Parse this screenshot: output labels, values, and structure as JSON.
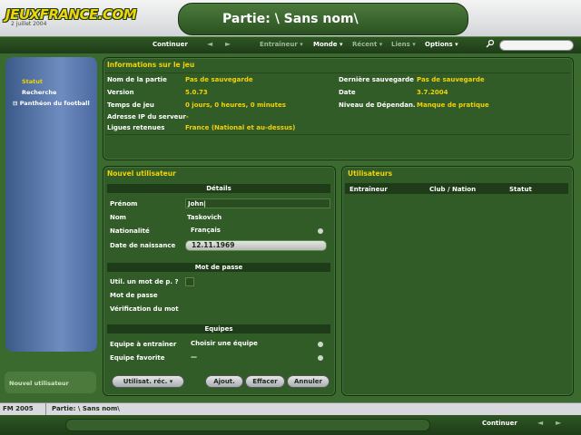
{
  "header": {
    "logo_text": "JEUXFRANCE.COM",
    "date": "2 juillet 2004",
    "title": "Partie: \\ Sans nom\\"
  },
  "nav": {
    "continue": "Continuer",
    "back": "◄",
    "forward": "►",
    "items": [
      "Entraîneur ▾",
      "Monde ▾",
      "Récent ▾",
      "Liens ▾",
      "Options ▾"
    ],
    "search_icon": "magnifier-icon"
  },
  "sidebar": {
    "items": [
      "Statut",
      "Recherche",
      "Panthéon du football"
    ],
    "bottom_label": "Nouvel utilisateur"
  },
  "info": {
    "title": "Informations sur le jeu",
    "rows_left": [
      {
        "label": "Nom de la partie",
        "value": "Pas de sauvegarde"
      },
      {
        "label": "Version",
        "value": "5.0.73"
      },
      {
        "label": "Temps de jeu",
        "value": "0 jours, 0 heures, 0 minutes"
      },
      {
        "label": "Adresse IP du serveur",
        "value": "-"
      },
      {
        "label": "Ligues retenues",
        "value": "France (National et au-dessus)"
      }
    ],
    "rows_right": [
      {
        "label": "Dernière sauvegarde",
        "value": "Pas de sauvegarde"
      },
      {
        "label": "Date",
        "value": "3.7.2004"
      },
      {
        "label": "Niveau de Dépendan.",
        "value": "Manque de pratique"
      }
    ]
  },
  "new_user": {
    "title": "Nouvel utilisateur",
    "details_header": "Détails",
    "firstname_label": "Prénom",
    "firstname_value": "John",
    "lastname_label": "Nom",
    "lastname_value": "Taskovich",
    "nationality_label": "Nationalité",
    "nationality_value": "Français",
    "dob_label": "Date de naissance",
    "dob_value": "12.11.1969",
    "password_header": "Mot de passe",
    "use_password_label": "Util. un mot de p. ?",
    "password_label": "Mot de passe",
    "verify_label": "Vérification du mot",
    "teams_header": "Equipes",
    "team_label": "Equipe à entraîner",
    "team_value": "Choisir une équipe",
    "fav_team_label": "Equipe favorite",
    "fav_team_value": "—",
    "buttons": {
      "recent": "Utilisat. réc. ▾",
      "add": "Ajout.",
      "clear": "Effacer",
      "cancel": "Annuler"
    }
  },
  "users": {
    "title": "Utilisateurs",
    "columns": [
      "Entraîneur",
      "Club / Nation",
      "Statut"
    ]
  },
  "status": {
    "app": "FM 2005",
    "game": "Partie: \\ Sans nom\\"
  },
  "footer": {
    "continue": "Continuer",
    "back": "◄",
    "forward": "►"
  }
}
